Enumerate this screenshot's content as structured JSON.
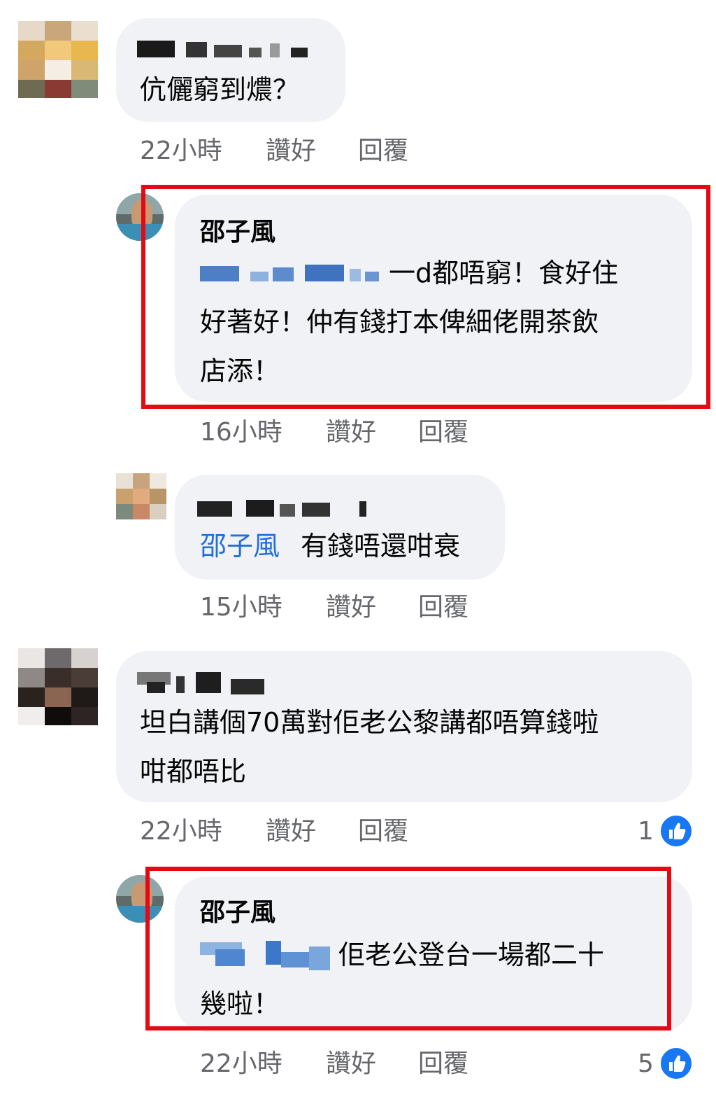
{
  "comments": [
    {
      "name": "",
      "text_lines": [
        "伉儷窮到燶？"
      ],
      "meta": {
        "time": "22小時",
        "like": "讚好",
        "reply": "回覆"
      }
    },
    {
      "name": "邵子風",
      "text_lines": [
        "一d都唔窮！食好住",
        "好著好！仲有錢打本俾細佬開茶飲",
        "店添！"
      ],
      "meta": {
        "time": "16小時",
        "like": "讚好",
        "reply": "回覆"
      }
    },
    {
      "name": "",
      "mention": "邵子風",
      "text_lines": [
        "有錢唔還咁衰"
      ],
      "meta": {
        "time": "15小時",
        "like": "讚好",
        "reply": "回覆"
      }
    },
    {
      "name": "",
      "text_lines": [
        "坦白講個70萬對佢老公黎講都唔算錢啦",
        "咁都唔比"
      ],
      "meta": {
        "time": "22小時",
        "like": "讚好",
        "reply": "回覆"
      },
      "reactions": {
        "count": "1",
        "icon": "thumbs-up-icon"
      }
    },
    {
      "name": "邵子風",
      "text_lines": [
        "佢老公登台一場都二十",
        "幾啦！"
      ],
      "meta": {
        "time": "22小時",
        "like": "讚好",
        "reply": "回覆"
      },
      "reactions": {
        "count": "5",
        "icon": "thumbs-up-icon"
      }
    }
  ],
  "colors": {
    "bubble": "#f0f2f5",
    "highlight": "#e50914",
    "mention": "#216fdb",
    "like": "#1877f2"
  }
}
